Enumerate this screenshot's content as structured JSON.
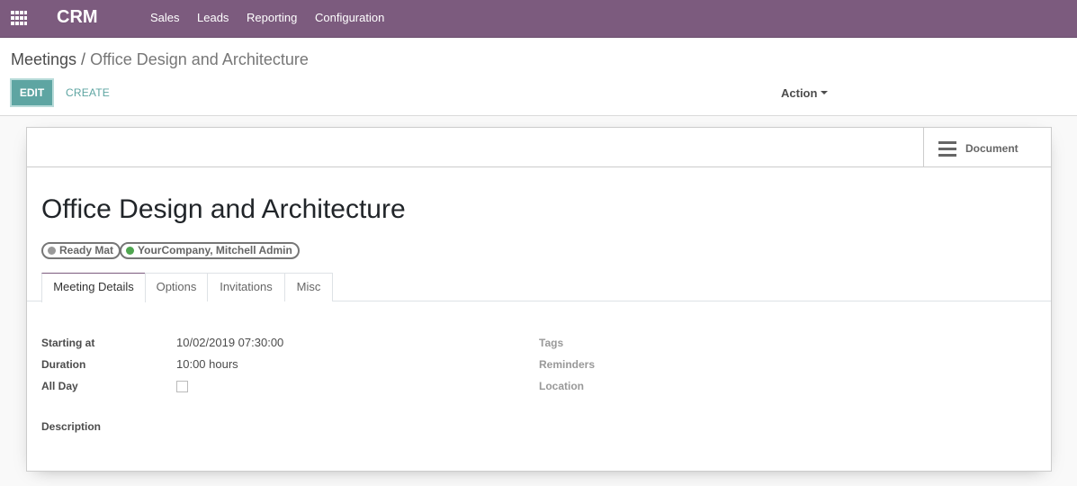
{
  "navbar": {
    "brand": "CRM",
    "menu": [
      "Sales",
      "Leads",
      "Reporting",
      "Configuration"
    ]
  },
  "breadcrumb": {
    "parent": "Meetings",
    "separator": "/",
    "current": "Office Design and Architecture"
  },
  "toolbar": {
    "edit_label": "EDIT",
    "create_label": "CREATE",
    "action_label": "Action"
  },
  "form": {
    "document_button_label": "Document",
    "title": "Office Design and Architecture",
    "tags": [
      {
        "label": "Ready Mat",
        "color": "#999999"
      },
      {
        "label": "YourCompany, Mitchell Admin",
        "color": "#4fa650"
      }
    ],
    "tabs": [
      "Meeting Details",
      "Options",
      "Invitations",
      "Misc"
    ],
    "active_tab": "Meeting Details",
    "fields": {
      "starting_at_label": "Starting at",
      "starting_at_value": "10/02/2019 07:30:00",
      "duration_label": "Duration",
      "duration_value": "10:00 hours",
      "all_day_label": "All Day",
      "all_day_checked": false,
      "description_label": "Description",
      "tags_label": "Tags",
      "reminders_label": "Reminders",
      "location_label": "Location"
    }
  },
  "colors": {
    "navbar": "#7c5b7e",
    "primary_button": "#5ea5a2"
  }
}
